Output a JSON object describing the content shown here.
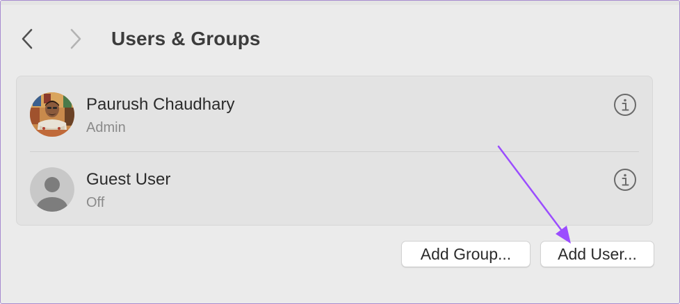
{
  "header": {
    "title": "Users & Groups",
    "back_icon": "chevron-left-icon",
    "forward_icon": "chevron-right-icon"
  },
  "users": [
    {
      "name": "Paurush Chaudhary",
      "role": "Admin",
      "avatar": "profile-photo",
      "info_icon": "info-circle-icon"
    },
    {
      "name": "Guest User",
      "role": "Off",
      "avatar": "generic-person-icon",
      "info_icon": "info-circle-icon"
    }
  ],
  "actions": {
    "add_group_label": "Add Group...",
    "add_user_label": "Add User..."
  },
  "colors": {
    "window_background": "#ebebeb",
    "list_background": "#e3e3e3",
    "annotation_arrow": "#9b4dff",
    "frame_border": "#a78bcf"
  }
}
